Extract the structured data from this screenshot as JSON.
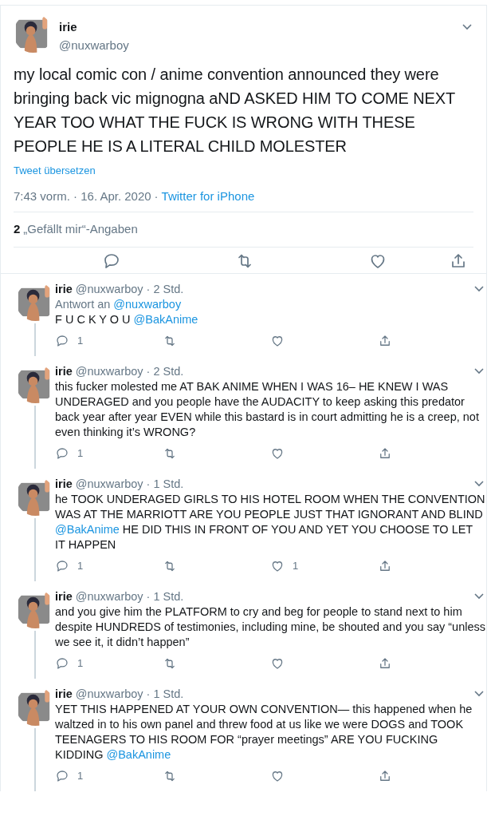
{
  "main_tweet": {
    "name": "irie",
    "handle": "@nuxwarboy",
    "text": "my local comic con / anime convention announced they were bringing back vic mignogna aND ASKED HIM TO COME NEXT YEAR TOO WHAT THE FUCK IS WRONG WITH THESE PEOPLE HE IS A LITERAL CHILD MOLESTER",
    "translate": "Tweet übersetzen",
    "time": "7:43 vorm. · 16. Apr. 2020",
    "dot": "·",
    "source": "Twitter for iPhone",
    "likes_count": "2",
    "likes_label": "„Gefällt mir“-Angaben"
  },
  "replies": [
    {
      "name": "irie",
      "handle": "@nuxwarboy",
      "age": "· 2 Std.",
      "reply_to": {
        "label": "Antwort an",
        "mention": "@nuxwarboy"
      },
      "body": [
        {
          "kind": "text",
          "text": "F U C K Y O U "
        },
        {
          "kind": "mention",
          "text": "@BakAnime"
        }
      ],
      "reply_count": "1"
    },
    {
      "name": "irie",
      "handle": "@nuxwarboy",
      "age": "· 2 Std.",
      "body": [
        {
          "kind": "text",
          "text": "this fucker molested me AT BAK ANIME WHEN I WAS 16– HE KNEW I WAS UNDERAGED and you people have the AUDACITY to keep asking this predator back year after year EVEN while this bastard is in court admitting he is a creep, not even thinking it’s WRONG?"
        }
      ],
      "reply_count": "1"
    },
    {
      "name": "irie",
      "handle": "@nuxwarboy",
      "age": "· 1 Std.",
      "body": [
        {
          "kind": "text",
          "text": "he TOOK UNDERAGED GIRLS TO HIS HOTEL ROOM WHEN THE CONVENTION WAS AT THE MARRIOTT ARE YOU PEOPLE JUST THAT IGNORANT AND BLIND "
        },
        {
          "kind": "mention",
          "text": "@BakAnime"
        },
        {
          "kind": "text",
          "text": " HE DID THIS IN FRONT OF YOU AND YET YOU CHOOSE TO LET IT HAPPEN"
        }
      ],
      "reply_count": "1",
      "like_count": "1"
    },
    {
      "name": "irie",
      "handle": "@nuxwarboy",
      "age": "· 1 Std.",
      "body": [
        {
          "kind": "text",
          "text": "and you give him the PLATFORM to cry and beg for people to stand next to him despite HUNDREDS of testimonies, including mine, be shouted and you say “unless we see it, it didn’t happen”"
        }
      ],
      "reply_count": "1"
    },
    {
      "name": "irie",
      "handle": "@nuxwarboy",
      "age": "· 1 Std.",
      "body": [
        {
          "kind": "text",
          "text": "YET THIS HAPPENED AT YOUR OWN CONVENTION— this happened when he waltzed in to his own panel and threw food at us like we were DOGS and TOOK TEENAGERS TO HIS ROOM FOR “prayer meetings” ARE YOU FUCKING KIDDING "
        },
        {
          "kind": "mention",
          "text": "@BakAnime"
        }
      ],
      "reply_count": "1"
    }
  ]
}
